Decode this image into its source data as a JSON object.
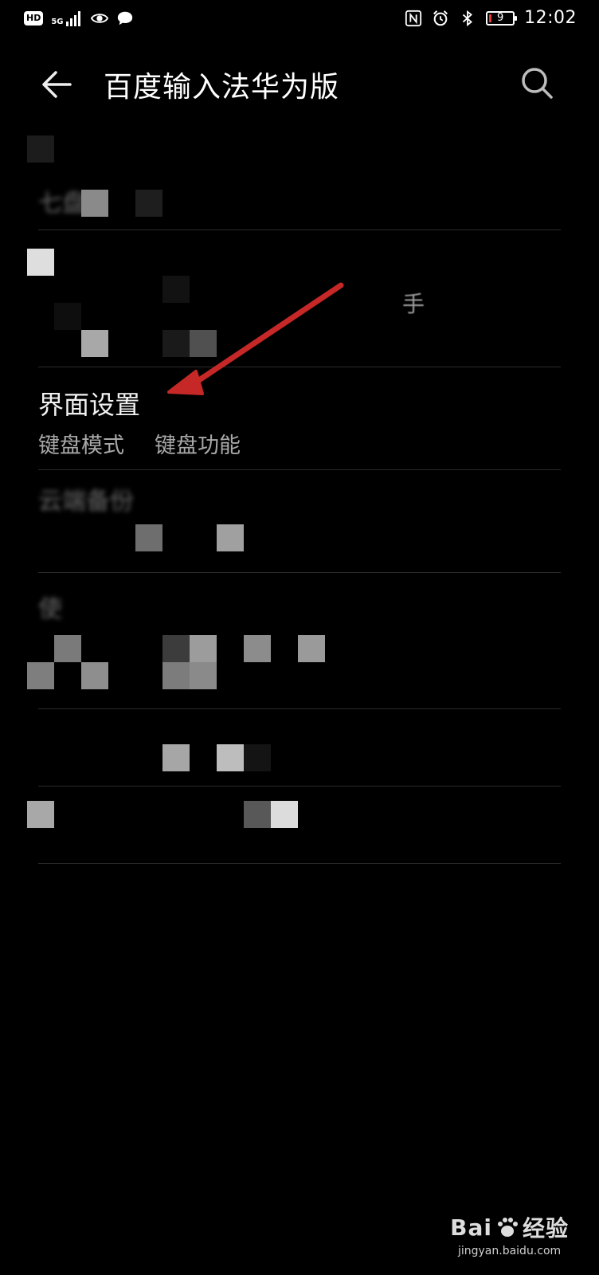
{
  "statusbar": {
    "hd_label": "HD",
    "network_label": "5G",
    "time": "12:02",
    "battery_level": "9",
    "icons": [
      "hd-icon",
      "signal-icon",
      "eye-icon",
      "message-icon",
      "nfc-icon",
      "alarm-icon",
      "bluetooth-icon",
      "battery-icon"
    ]
  },
  "appbar": {
    "title": "百度输入法华为版",
    "back_icon": "back-arrow-icon",
    "search_icon": "search-icon"
  },
  "obscured": {
    "row1_fragment": "七盘",
    "row2_fragment": "手",
    "row4_fragment": "云端备份",
    "row5_fragment": "使"
  },
  "interface_settings": {
    "title": "界面设置",
    "sub1": "键盘模式",
    "sub2": "键盘功能"
  },
  "watermark": {
    "brand": "Bai",
    "brand_suffix": "经验",
    "url": "jingyan.baidu.com"
  },
  "colors": {
    "background": "#000000",
    "arrow": "#c62828",
    "battery_low": "#e53935"
  }
}
